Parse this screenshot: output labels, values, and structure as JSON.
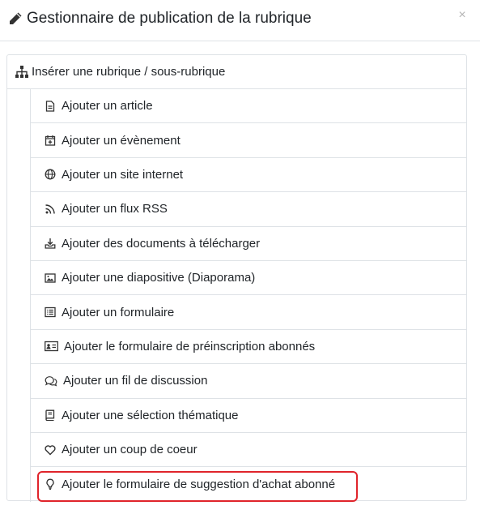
{
  "modal": {
    "title": "Gestionnaire de publication de la rubrique",
    "close_label": "×"
  },
  "panel": {
    "header_label": "Insérer une rubrique / sous-rubrique",
    "items": [
      {
        "label": "Ajouter un article",
        "icon": "file-icon"
      },
      {
        "label": "Ajouter un évènement",
        "icon": "calendar-plus-icon"
      },
      {
        "label": "Ajouter un site internet",
        "icon": "globe-icon"
      },
      {
        "label": "Ajouter un flux RSS",
        "icon": "rss-icon"
      },
      {
        "label": "Ajouter des documents à télécharger",
        "icon": "download-tray-icon"
      },
      {
        "label": "Ajouter une diapositive (Diaporama)",
        "icon": "image-icon"
      },
      {
        "label": "Ajouter un formulaire",
        "icon": "list-icon"
      },
      {
        "label": "Ajouter le formulaire de préinscription abonnés",
        "icon": "id-card-icon"
      },
      {
        "label": "Ajouter un fil de discussion",
        "icon": "comments-icon"
      },
      {
        "label": "Ajouter une sélection thématique",
        "icon": "book-icon"
      },
      {
        "label": "Ajouter un coup de coeur",
        "icon": "heart-icon"
      },
      {
        "label": "Ajouter le formulaire de suggestion d'achat abonné",
        "icon": "lightbulb-icon"
      }
    ]
  },
  "highlight_color": "#e0242b"
}
